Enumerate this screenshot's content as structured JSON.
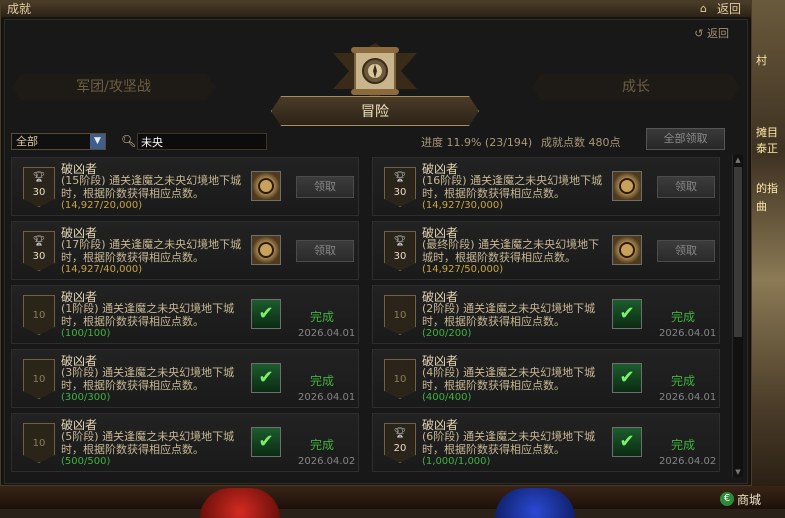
{
  "window": {
    "title": "成就",
    "back_label": "返回",
    "back_label_inner": "返回"
  },
  "tabs": {
    "left": "军团/攻坚战",
    "active": "冒险",
    "right": "成长"
  },
  "filter": {
    "selected": "全部"
  },
  "search": {
    "value": "未央"
  },
  "summary": {
    "progress": "进度 11.9% (23/194)",
    "points": "成就点数 480点",
    "claim_all": "全部领取"
  },
  "cards": [
    {
      "name": "破凶者",
      "desc": "(15阶段) 通关逢魔之未央幻境地下城时，根据阶数获得相应点数。",
      "progress": "(14,927/20,000)",
      "badge": "30",
      "done": false,
      "claim": "领取",
      "status": "",
      "date": ""
    },
    {
      "name": "破凶者",
      "desc": "(16阶段) 通关逢魔之未央幻境地下城时，根据阶数获得相应点数。",
      "progress": "(14,927/30,000)",
      "badge": "30",
      "done": false,
      "claim": "领取",
      "status": "",
      "date": ""
    },
    {
      "name": "破凶者",
      "desc": "(17阶段) 通关逢魔之未央幻境地下城时，根据阶数获得相应点数。",
      "progress": "(14,927/40,000)",
      "badge": "30",
      "done": false,
      "claim": "领取",
      "status": "",
      "date": ""
    },
    {
      "name": "破凶者",
      "desc": "(最终阶段) 通关逢魔之未央幻境地下城时，根据阶数获得相应点数。",
      "progress": "(14,927/50,000)",
      "badge": "30",
      "done": false,
      "claim": "领取",
      "status": "",
      "date": ""
    },
    {
      "name": "破凶者",
      "desc": "(1阶段) 通关逢魔之未央幻境地下城时，根据阶数获得相应点数。",
      "progress": "(100/100)",
      "badge": "10",
      "done": true,
      "claim": "",
      "status": "完成",
      "date": "2026.04.01"
    },
    {
      "name": "破凶者",
      "desc": "(2阶段) 通关逢魔之未央幻境地下城时，根据阶数获得相应点数。",
      "progress": "(200/200)",
      "badge": "10",
      "done": true,
      "claim": "",
      "status": "完成",
      "date": "2026.04.01"
    },
    {
      "name": "破凶者",
      "desc": "(3阶段) 通关逢魔之未央幻境地下城时，根据阶数获得相应点数。",
      "progress": "(300/300)",
      "badge": "10",
      "done": true,
      "claim": "",
      "status": "完成",
      "date": "2026.04.01"
    },
    {
      "name": "破凶者",
      "desc": "(4阶段) 通关逢魔之未央幻境地下城时，根据阶数获得相应点数。",
      "progress": "(400/400)",
      "badge": "10",
      "done": true,
      "claim": "",
      "status": "完成",
      "date": "2026.04.01"
    },
    {
      "name": "破凶者",
      "desc": "(5阶段) 通关逢魔之未央幻境地下城时，根据阶数获得相应点数。",
      "progress": "(500/500)",
      "badge": "10",
      "done": true,
      "claim": "",
      "status": "完成",
      "date": "2026.04.02"
    },
    {
      "name": "破凶者",
      "desc": "(6阶段) 通关逢魔之未央幻境地下城时，根据阶数获得相应点数。",
      "progress": "(1,000/1,000)",
      "badge": "20",
      "done": true,
      "claim": "",
      "status": "完成",
      "date": "2026.04.02"
    }
  ],
  "side_texts": [
    "村",
    "摊目",
    "泰正",
    "的指",
    "曲"
  ],
  "bottom": {
    "mall_label": "商城"
  },
  "colors": {
    "gold": "#c8a440",
    "done_green": "#3fb23f",
    "panel": "#181818"
  }
}
